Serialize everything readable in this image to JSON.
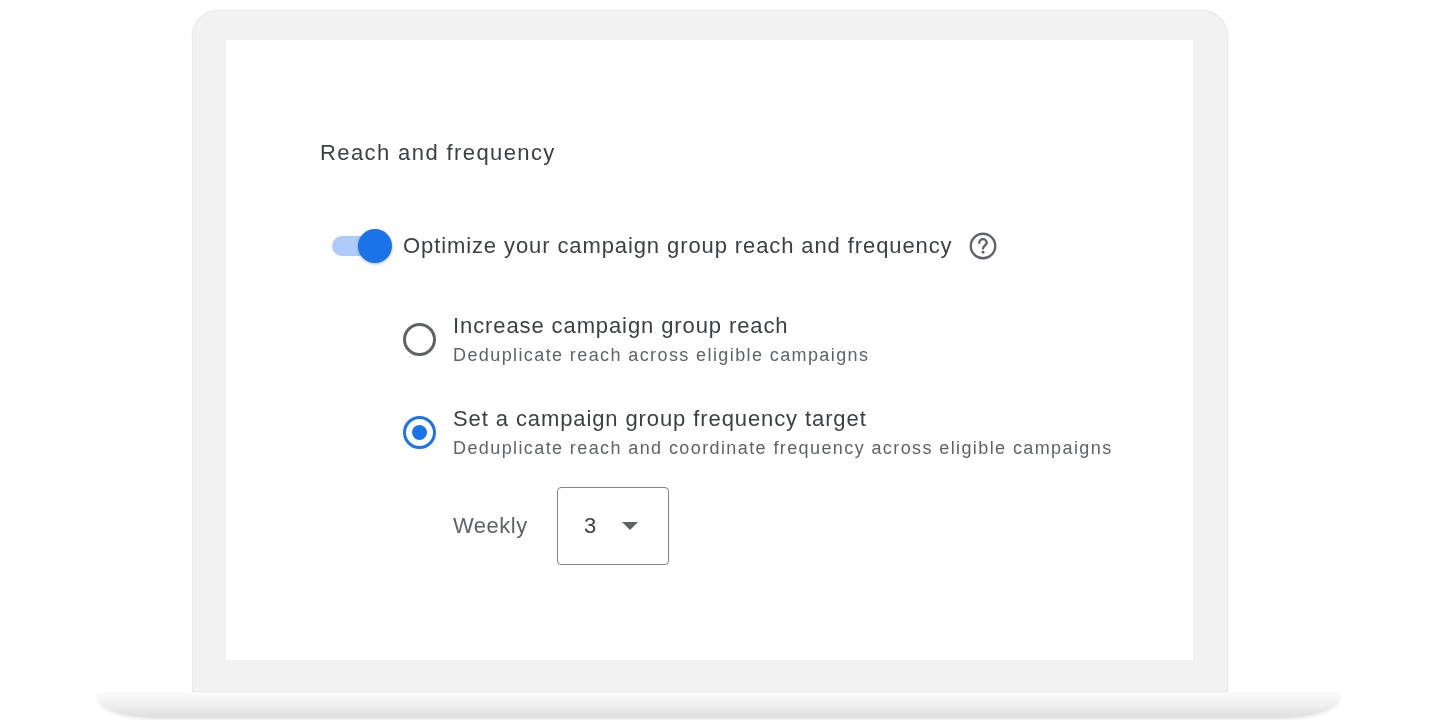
{
  "section": {
    "title": "Reach and frequency"
  },
  "optimize_toggle": {
    "label": "Optimize your campaign group reach and frequency",
    "on": true
  },
  "options": [
    {
      "label": "Increase campaign group reach",
      "description": "Deduplicate reach across eligible campaigns",
      "selected": false
    },
    {
      "label": "Set a campaign group frequency target",
      "description": "Deduplicate reach and coordinate frequency across eligible campaigns",
      "selected": true
    }
  ],
  "frequency": {
    "label": "Weekly",
    "value": "3"
  }
}
